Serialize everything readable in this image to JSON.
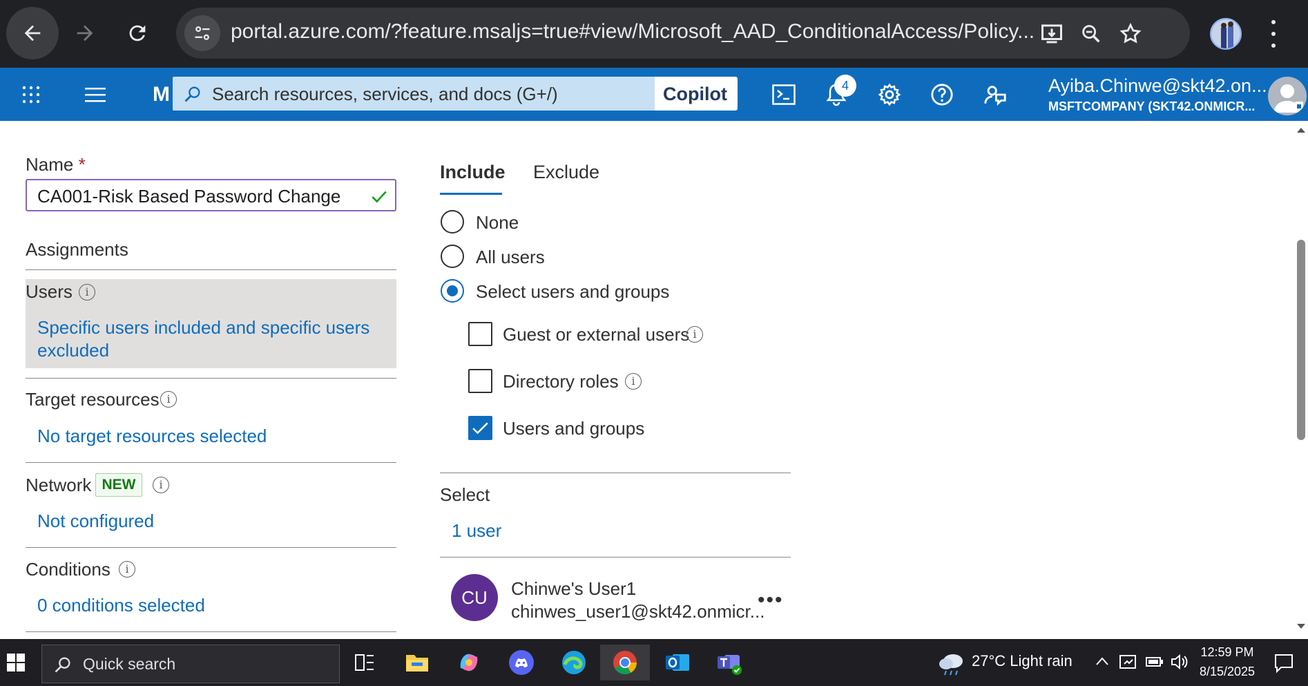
{
  "browser": {
    "url": "portal.azure.com/?feature.msaljs=true#view/Microsoft_AAD_ConditionalAccess/Policy..."
  },
  "azure": {
    "brand_letter": "M",
    "search_placeholder": "Search resources, services, and docs (G+/)",
    "copilot_label": "Copilot",
    "notification_count": "4",
    "account_name": "Ayiba.Chinwe@skt42.on...",
    "account_org": "MSFTCOMPANY (SKT42.ONMICR..."
  },
  "form": {
    "name_label": "Name",
    "required_mark": "*",
    "name_value": "CA001-Risk Based Password Change",
    "assignments_heading": "Assignments",
    "users_label": "Users",
    "users_summary_line1": "Specific users included and specific users",
    "users_summary_line2": "excluded",
    "target_label": "Target resources",
    "target_summary": "No target resources selected",
    "network_label": "Network",
    "network_badge": "NEW",
    "network_summary": "Not configured",
    "conditions_label": "Conditions",
    "conditions_summary": "0 conditions selected"
  },
  "panel": {
    "tab_include": "Include",
    "tab_exclude": "Exclude",
    "radio_none": "None",
    "radio_all": "All users",
    "radio_select": "Select users and groups",
    "cb_guest": "Guest or external users",
    "cb_roles": "Directory roles",
    "cb_users_groups": "Users and groups",
    "select_label": "Select",
    "select_link": "1 user",
    "user_initials": "CU",
    "user_name": "Chinwe's User1",
    "user_email": "chinwes_user1@skt42.onmicr...",
    "more_label": "•••"
  },
  "taskbar": {
    "search_label": "Quick search",
    "weather": "27°C  Light rain",
    "time": "12:59 PM",
    "date": "8/15/2025"
  }
}
